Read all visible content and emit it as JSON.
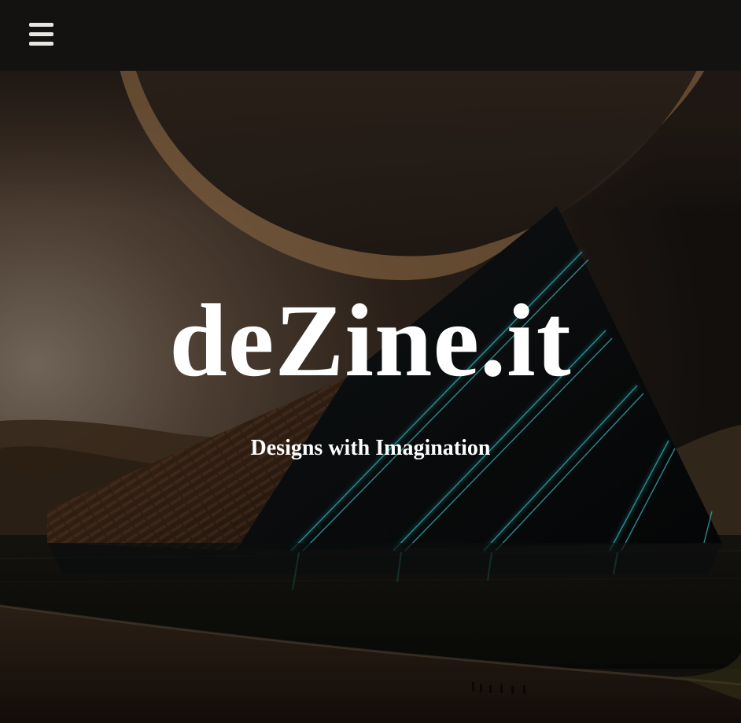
{
  "header": {
    "menu_icon": "hamburger-menu-icon"
  },
  "hero": {
    "title": "deZine.it",
    "tagline": "Designs with Imagination"
  },
  "colors": {
    "topbar": "#141211",
    "text": "#ffffff",
    "neon_accent": "#27c6cf"
  }
}
